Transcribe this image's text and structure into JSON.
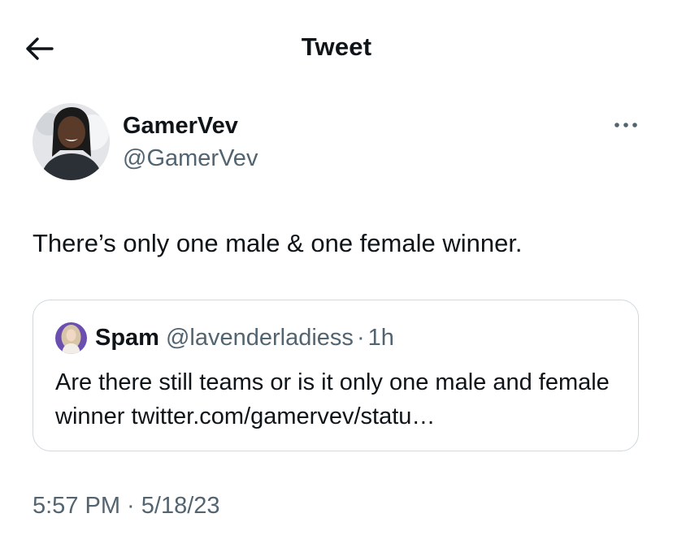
{
  "header": {
    "title": "Tweet"
  },
  "tweet": {
    "author_name": "GamerVev",
    "author_handle": "@GamerVev",
    "text": "There’s only one male & one female winner.",
    "time": "5:57 PM",
    "date": "5/18/23"
  },
  "quote": {
    "name": "Spam",
    "handle": "@lavenderladiess",
    "separator": "·",
    "age": "1h",
    "text": "Are there still teams or is it only one male and female winner twitter.com/gamervev/statu…"
  },
  "colors": {
    "text_primary": "#0f1419",
    "text_secondary": "#536471",
    "border": "#cfd9de"
  },
  "icons": {
    "back": "arrow-left-icon",
    "more": "ellipsis-icon"
  }
}
